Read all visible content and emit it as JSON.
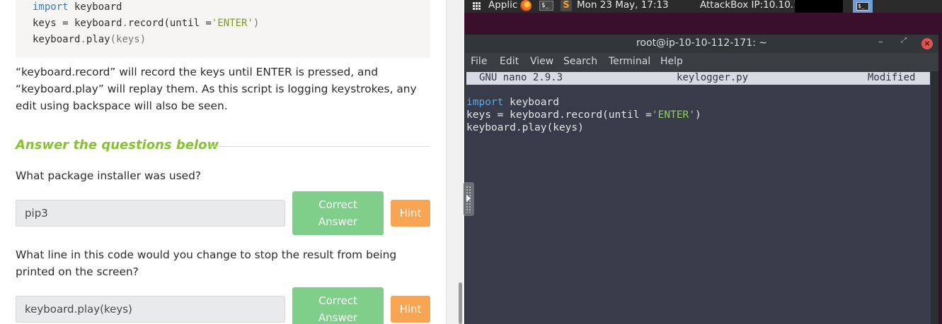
{
  "room": {
    "code_lines": [
      {
        "kw": "import",
        "rest": " keyboard"
      },
      {
        "a": "keys = keyboard",
        "b": ".",
        "c": "record(until =",
        "str": "'ENTER'",
        "d": ")"
      },
      {
        "a": "keyboard",
        "b": ".",
        "c": "play",
        "d": "(keys)"
      }
    ],
    "explanation": "“keyboard.record” will record the keys until ENTER is pressed, and “keyboard.play” will replay them. As this script is logging keystrokes, any edit using backspace will also be seen.",
    "answer_heading": "Answer the questions below",
    "questions": [
      {
        "text": "What package installer was used?",
        "answer": "pip3",
        "correct_label": "Correct Answer",
        "hint_label": "Hint"
      },
      {
        "text": "What line in this code would you change to stop the result from being printed on the screen?",
        "answer": "keyboard.play(keys)",
        "correct_label": "Correct Answer",
        "hint_label": "Hint"
      }
    ]
  },
  "desktop": {
    "panel": {
      "applications": "Applic",
      "clock": "Mon 23 May, 17:13",
      "attackbox": "AttackBox IP:10.10.112.171",
      "term_icon_text": "$_",
      "sublime_icon_text": "S"
    },
    "terminal": {
      "title": "root@ip-10-10-112-171: ~",
      "menu": [
        "File",
        "Edit",
        "View",
        "Search",
        "Terminal",
        "Help"
      ],
      "nano_version": "GNU nano 2.9.3",
      "nano_filename": "keylogger.py",
      "nano_status": "Modified",
      "lines": [
        {
          "kw": "import",
          "rest": " keyboard"
        },
        {
          "a": "keys = keyboard.record(until =",
          "str": "'ENTER'",
          "b": ")"
        },
        {
          "a": "keyboard.play(keys)"
        }
      ]
    }
  },
  "colors": {
    "heading_green": "#86c232",
    "correct_button": "#7fce8a",
    "hint_button": "#f7a552",
    "terminal_bg": "#383c4a",
    "desktop_bg": "#3a0f2c"
  },
  "icons": [
    "applications-grid-icon",
    "firefox-icon",
    "terminal-icon",
    "sublime-text-icon",
    "minimize-icon",
    "maximize-icon",
    "close-icon",
    "side-panel-arrow-icon"
  ]
}
